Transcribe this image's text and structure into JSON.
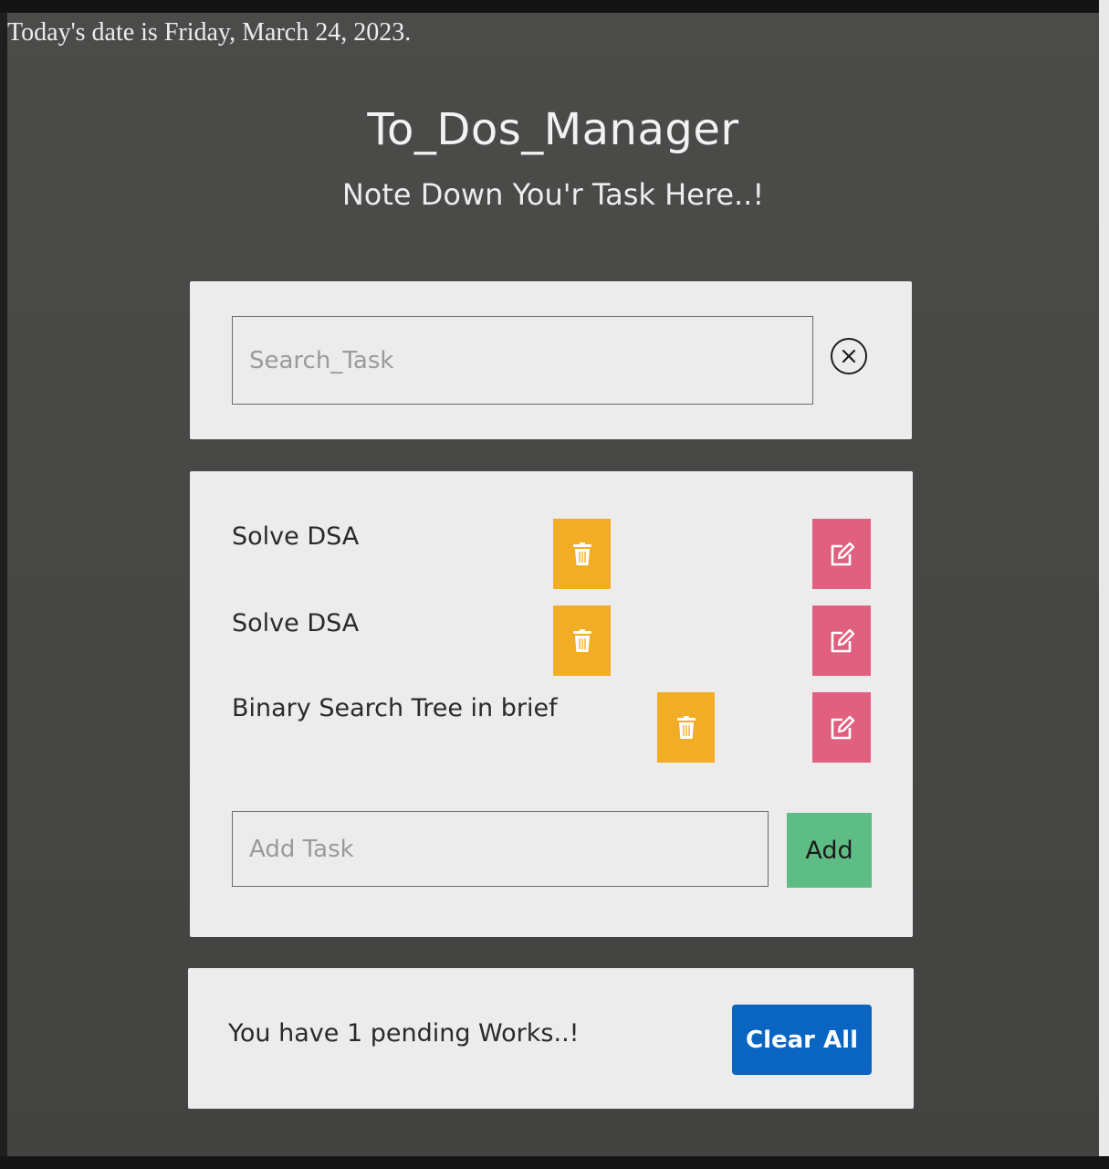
{
  "header": {
    "date_text": "Today's date is Friday, March 24, 2023.",
    "title": "To_Dos_Manager",
    "subtitle": "Note Down You'r Task Here..!"
  },
  "search": {
    "placeholder": "Search_Task",
    "value": "",
    "clear_icon": "close-circle-icon"
  },
  "tasks": [
    {
      "text": "Solve DSA",
      "delete_icon": "trash-icon",
      "edit_icon": "edit-icon"
    },
    {
      "text": "Solve DSA",
      "delete_icon": "trash-icon",
      "edit_icon": "edit-icon"
    },
    {
      "text": "Binary Search Tree in brief",
      "delete_icon": "trash-icon",
      "edit_icon": "edit-icon"
    }
  ],
  "add_task": {
    "placeholder": "Add Task",
    "value": "",
    "button_label": "Add"
  },
  "footer": {
    "pending_text": "You have 1 pending Works..!",
    "clear_all_label": "Clear All"
  },
  "colors": {
    "background": "#474745",
    "card": "#ececec",
    "delete_button": "#f2ad26",
    "edit_button": "#e2607f",
    "add_button": "#5dbd84",
    "clear_all_button": "#0a64c2"
  }
}
